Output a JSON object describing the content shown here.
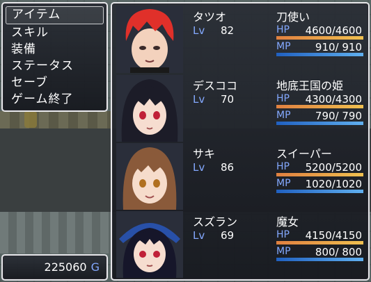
{
  "menu": {
    "commands": [
      {
        "label": "アイテム",
        "selected": true
      },
      {
        "label": "スキル",
        "selected": false
      },
      {
        "label": "装備",
        "selected": false
      },
      {
        "label": "ステータス",
        "selected": false
      },
      {
        "label": "セーブ",
        "selected": false
      },
      {
        "label": "ゲーム終了",
        "selected": false
      }
    ]
  },
  "gold": {
    "amount": "225060",
    "unit": "G"
  },
  "party": [
    {
      "name": "タツオ",
      "class": "刀使い",
      "level_label": "Lv",
      "level": "82",
      "hp_label": "HP",
      "hp": "4600/4600",
      "hp_ratio": 1.0,
      "mp_label": "MP",
      "mp": " 910/ 910",
      "mp_ratio": 1.0,
      "hair": "#e0302a"
    },
    {
      "name": "デスココ",
      "class": "地底王国の姫",
      "level_label": "Lv",
      "level": "70",
      "hp_label": "HP",
      "hp": "4300/4300",
      "hp_ratio": 1.0,
      "mp_label": "MP",
      "mp": " 790/ 790",
      "mp_ratio": 1.0,
      "hair": "#1c1c28"
    },
    {
      "name": "サキ",
      "class": "スイーパー",
      "level_label": "Lv",
      "level": "86",
      "hp_label": "HP",
      "hp": "5200/5200",
      "hp_ratio": 1.0,
      "mp_label": "MP",
      "mp": "1020/1020",
      "mp_ratio": 1.0,
      "hair": "#8a5a3a"
    },
    {
      "name": "スズラン",
      "class": "魔女",
      "level_label": "Lv",
      "level": "69",
      "hp_label": "HP",
      "hp": "4150/4150",
      "hp_ratio": 1.0,
      "mp_label": "MP",
      "mp": " 800/ 800",
      "mp_ratio": 1.0,
      "hair": "#16162a"
    }
  ],
  "colors": {
    "system_blue": "#84a9ff",
    "hp_gauge": "#f0a040",
    "mp_gauge": "#3080e0"
  }
}
